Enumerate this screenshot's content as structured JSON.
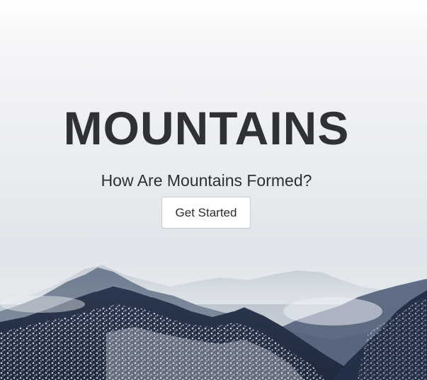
{
  "hero": {
    "title": "MOUNTAINS",
    "subtitle": "How Are Mountains Formed?",
    "cta_label": "Get Started"
  },
  "colors": {
    "title_text": "#303133",
    "button_border": "#c9ccd1",
    "mountain_dark": "#27334a",
    "snow": "#e8ebef"
  }
}
